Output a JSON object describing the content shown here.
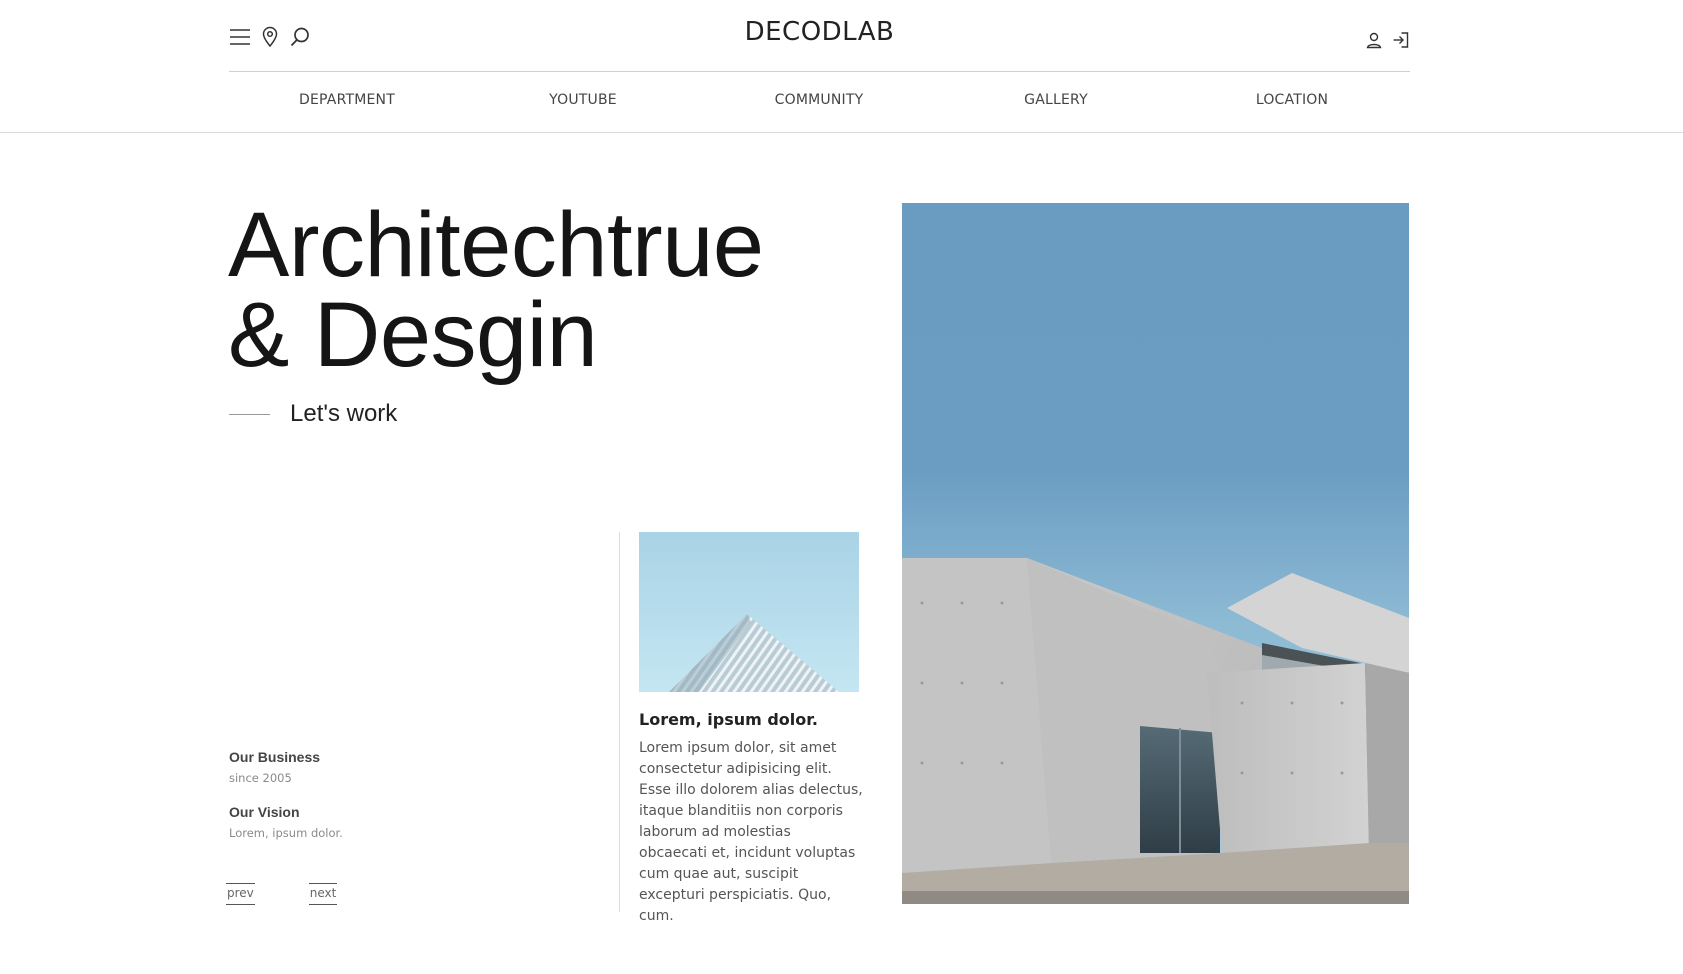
{
  "header": {
    "logo": "DECODLAB",
    "icons": {
      "menu": "menu-icon",
      "location": "map-pin-icon",
      "search": "search-icon",
      "user": "user-icon",
      "login": "login-icon"
    }
  },
  "nav": {
    "items": [
      {
        "label": "DEPARTMENT"
      },
      {
        "label": "YOUTUBE"
      },
      {
        "label": "COMMUNITY"
      },
      {
        "label": "GALLERY"
      },
      {
        "label": "LOCATION"
      }
    ]
  },
  "hero": {
    "title_line1": "Architechtrue",
    "title_line2": "& Desgin",
    "cta": "Let's work"
  },
  "info": {
    "business_title": "Our Business",
    "business_sub": "since 2005",
    "vision_title": "Our Vision",
    "vision_sub": "Lorem, ipsum dolor."
  },
  "pager": {
    "prev": "prev",
    "next": "next"
  },
  "card": {
    "title": "Lorem, ipsum dolor.",
    "text": "Lorem ipsum dolor, sit amet consectetur adipisicing elit. Esse illo dolorem alias delectus, itaque blanditiis non corporis laborum ad molestias obcaecati et, incidunt voluptas cum quae aut, suscipit excepturi perspiciatis. Quo, cum."
  },
  "colors": {
    "text": "#151515",
    "sky": "#6b9cc2",
    "concrete": "#c9c9c9",
    "thumb_sky": "#b6dbe8"
  }
}
